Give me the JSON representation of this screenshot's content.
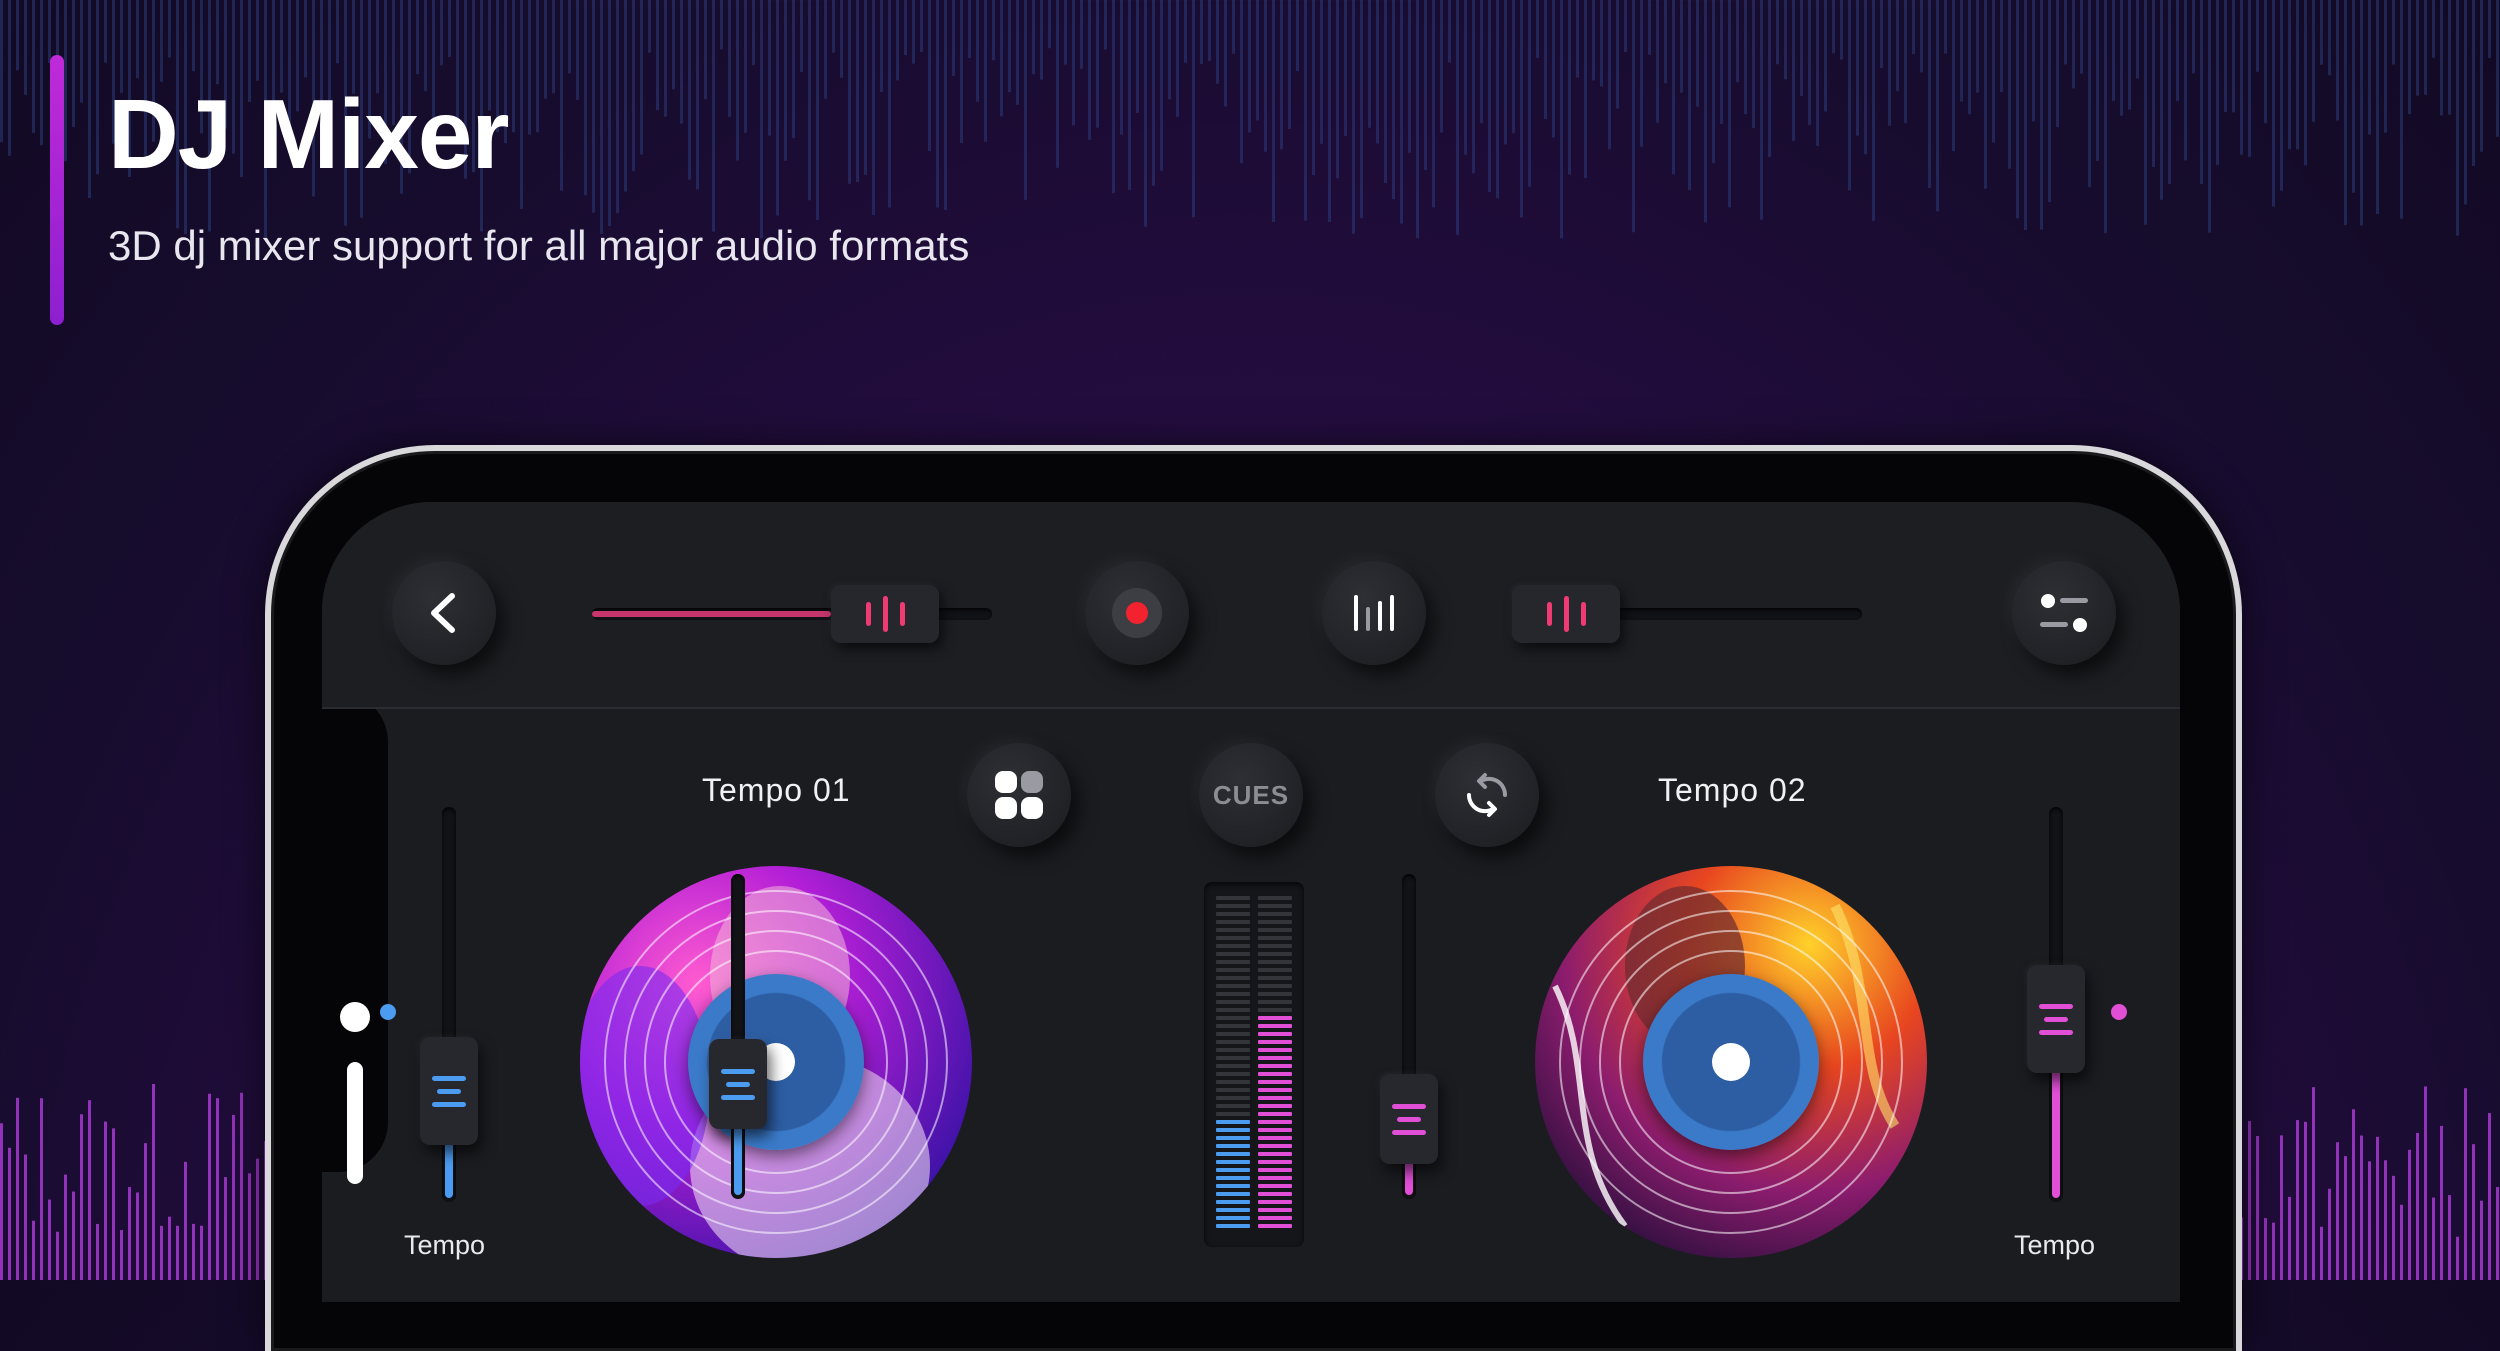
{
  "header": {
    "title": "DJ Mixer",
    "subtitle": "3D dj mixer support for all major audio formats"
  },
  "topbar": {
    "back_icon": "chevron-left-icon",
    "record_icon": "record-icon",
    "equalizer_icon": "equalizer-icon",
    "settings_icon": "sliders-icon",
    "left_crossfader_level": 0.82,
    "right_crossfader_level": 0.0
  },
  "controls": {
    "grid_icon": "grid-icon",
    "cues_label": "CUES",
    "sync_icon": "sync-icon"
  },
  "deck_left": {
    "label": "Tempo 01",
    "tempo_label": "Tempo",
    "tempo_level": 0.2,
    "volume_level": 0.3,
    "accent": "#4b9bf0"
  },
  "deck_right": {
    "label": "Tempo 02",
    "tempo_label": "Tempo",
    "tempo_level": 0.45,
    "volume_level": 0.15,
    "accent": "#e24fd7"
  },
  "vu_meter": {
    "left_level": 0.34,
    "right_level": 0.64
  }
}
